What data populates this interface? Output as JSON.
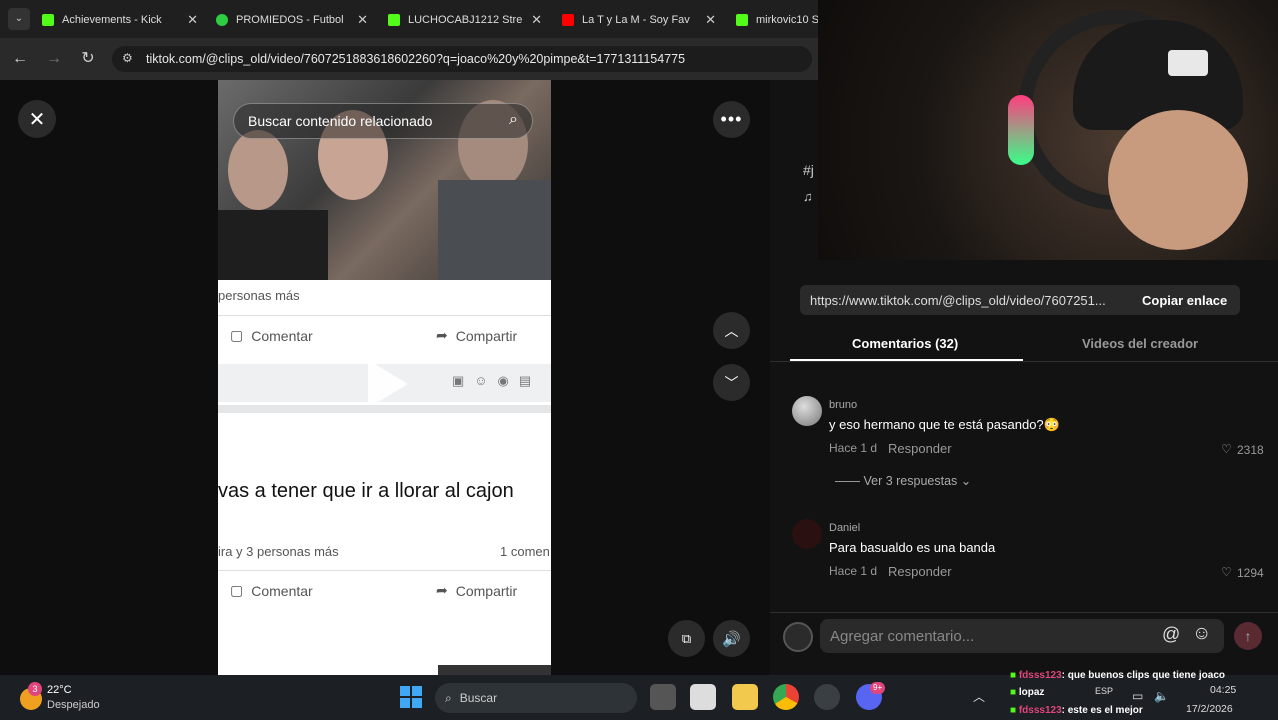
{
  "browser": {
    "tabs": [
      {
        "title": "Achievements - Kick",
        "color": "#53fc18"
      },
      {
        "title": "PROMIEDOS - Futbol",
        "color": "#2ecc40"
      },
      {
        "title": "LUCHOCABJ1212 Stre",
        "color": "#53fc18"
      },
      {
        "title": "La T y La M - Soy Fav",
        "color": "#ff0000"
      },
      {
        "title": "mirkovic10 S",
        "color": "#53fc18"
      }
    ],
    "url": "tiktok.com/@clips_old/video/7607251883618602260?q=joaco%20y%20pimpe&t=1771311154775"
  },
  "video": {
    "search_placeholder": "Buscar contenido relacionado",
    "line1": "personas más",
    "comment_label": "Comentar",
    "share_label": "Compartir",
    "caption": "vas a tener que ir a llorar al cajon",
    "line2": "ira y 3 personas más",
    "line3": "1 comen",
    "comment_label2": "Comentar",
    "share_label2": "Compartir"
  },
  "side": {
    "link": "https://www.tiktok.com/@clips_old/video/7607251...",
    "copy_label": "Copiar enlace",
    "tab_comments": "Comentarios (32)",
    "tab_videos": "Videos del creador",
    "comments": [
      {
        "user": "bruno",
        "text": "y eso hermano que te está pasando?😳",
        "time": "Hace 1 d",
        "reply": "Responder",
        "likes": "2318",
        "replies": "Ver 3 respuestas"
      },
      {
        "user": "Daniel",
        "text": "Para basualdo es una banda",
        "time": "Hace 1 d",
        "reply": "Responder",
        "likes": "1294"
      }
    ],
    "comment_placeholder": "Agregar comentario..."
  },
  "taskbar": {
    "weather_temp": "22°C",
    "weather_desc": "Despejado",
    "weather_badge": "3",
    "search": "Buscar",
    "lang": "ESP",
    "time": "04:25",
    "date": "17/2/2026",
    "discord_badge": "9+"
  },
  "chat_overlay": [
    {
      "user": "fdsss123",
      "msg": ": que buenos clips que tiene joaco"
    },
    {
      "user": "lopaz",
      "msg": ""
    },
    {
      "user": "fdsss123",
      "msg": ": este es el mejor"
    }
  ]
}
